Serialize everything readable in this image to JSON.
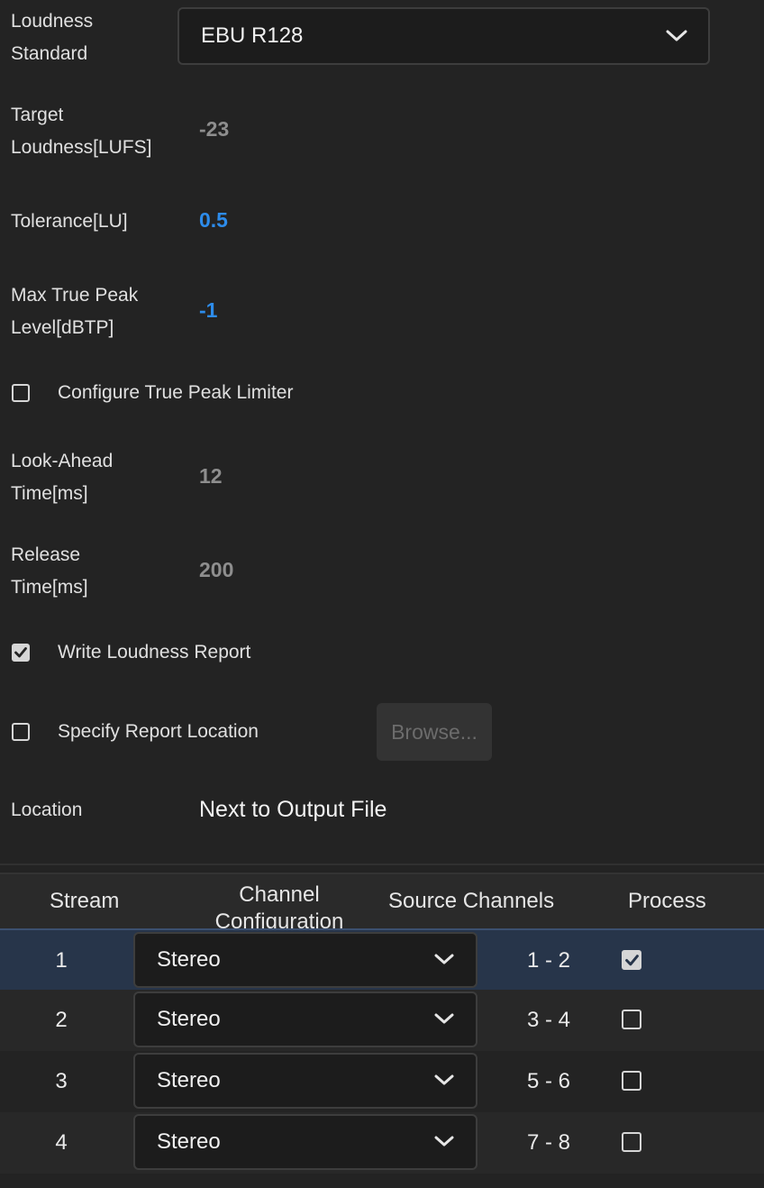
{
  "fields": {
    "loudness_standard_label": "Loudness Standard",
    "loudness_standard_value": "EBU R128",
    "target_loudness_label": "Target Loudness[LUFS]",
    "target_loudness_value": "-23",
    "tolerance_label": "Tolerance[LU]",
    "tolerance_value": "0.5",
    "max_true_peak_label": "Max True Peak Level[dBTP]",
    "max_true_peak_value": "-1",
    "configure_limiter_label": "Configure True Peak Limiter",
    "configure_limiter_checked": false,
    "look_ahead_label": "Look-Ahead Time[ms]",
    "look_ahead_value": "12",
    "release_time_label": "Release Time[ms]",
    "release_time_value": "200",
    "write_report_label": "Write Loudness Report",
    "write_report_checked": true,
    "specify_location_label": "Specify Report Location",
    "specify_location_checked": false,
    "browse_button_label": "Browse...",
    "location_label": "Location",
    "location_value": "Next to Output File"
  },
  "table": {
    "headers": {
      "stream": "Stream",
      "channel_config": "Channel Configuration",
      "source_channels": "Source Channels",
      "process": "Process"
    },
    "rows": [
      {
        "stream": "1",
        "config": "Stereo",
        "source": "1 - 2",
        "process": true,
        "selected": true
      },
      {
        "stream": "2",
        "config": "Stereo",
        "source": "3 - 4",
        "process": false
      },
      {
        "stream": "3",
        "config": "Stereo",
        "source": "5 - 6",
        "process": false
      },
      {
        "stream": "4",
        "config": "Stereo",
        "source": "7 - 8",
        "process": false
      }
    ]
  },
  "colors": {
    "background": "#232323",
    "accent_blue": "#2d8ceb",
    "selected_row": "#27354a"
  },
  "icons": {
    "dropdown": "chevron-down-icon",
    "checkbox_checked": "checkmark-icon"
  }
}
